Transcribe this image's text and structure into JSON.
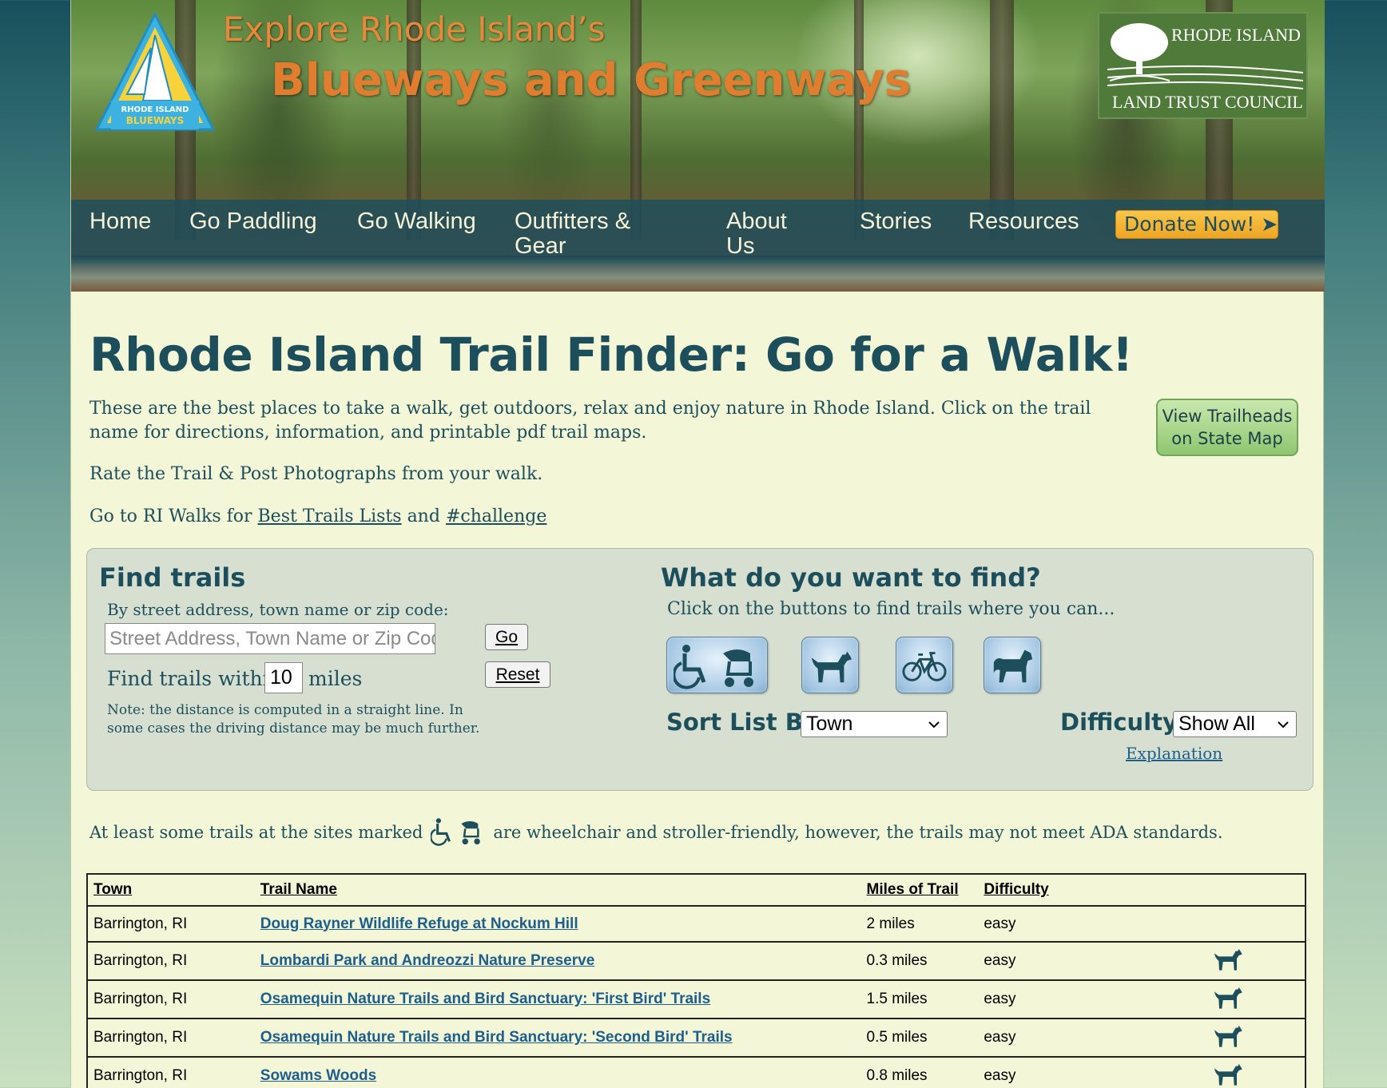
{
  "header": {
    "title_line1": "Explore Rhode Island’s",
    "title_line2": "Blueways and Greenways",
    "logo_text": [
      "RHODE ISLAND",
      "BLUEWAYS"
    ],
    "partner_logo": [
      "RHODE ISLAND",
      "LAND TRUST COUNCIL"
    ]
  },
  "nav": {
    "items": [
      "Home",
      "Go Paddling",
      "Go Walking",
      "Outfitters & Gear",
      "About Us",
      "Stories",
      "Resources"
    ],
    "donate": "Donate Now! ➤"
  },
  "page": {
    "title": "Rhode Island Trail Finder: Go for a Walk!",
    "intro1": "These are the best places to take a walk, get outdoors, relax and enjoy nature in Rhode Island. Click on the trail name for directions, information, and printable pdf trail maps.",
    "intro2": "Rate the Trail & Post Photographs from your walk.",
    "intro3_prefix": "Go to RI Walks for",
    "intro3_link1": "Best Trails Lists",
    "intro3_and": "and",
    "intro3_link2": "#challenge",
    "map_button": [
      "View Trailheads",
      "on State Map"
    ]
  },
  "find": {
    "heading": "Find trails",
    "address_label": "By street address, town name or zip code:",
    "address_placeholder": "Street Address, Town Name or Zip Code",
    "address_value": "",
    "go_label": "Go",
    "reset_label": "Reset",
    "within_prefix": "Find trails within",
    "within_value": "10",
    "within_suffix": "miles",
    "note": "Note: the distance is computed in a straight line. In some cases the driving distance may be much further."
  },
  "what": {
    "heading": "What do you want to find?",
    "subtitle": "Click on the buttons to find trails where you can...",
    "filters": [
      "wheelchair-stroller-icon",
      "dog-icon",
      "bicycle-icon",
      "horse-icon"
    ],
    "sort_label": "Sort List By:",
    "sort_value": "Town",
    "difficulty_label": "Difficulty:",
    "difficulty_value": "Show All",
    "explanation": "Explanation"
  },
  "ada_note": {
    "prefix": "At least some trails at the sites marked",
    "suffix": "are wheelchair and stroller-friendly, however, the trails may not meet ADA standards."
  },
  "table": {
    "headers": [
      "Town",
      "Trail Name",
      "Miles of Trail",
      "Difficulty"
    ],
    "rows": [
      {
        "town": "Barrington, RI",
        "name": "Doug Rayner Wildlife Refuge at Nockum Hill",
        "miles": "2 miles",
        "difficulty": "easy",
        "dog": false
      },
      {
        "town": "Barrington, RI",
        "name": "Lombardi Park and Andreozzi Nature Preserve",
        "miles": "0.3 miles",
        "difficulty": "easy",
        "dog": true
      },
      {
        "town": "Barrington, RI",
        "name": "Osamequin Nature Trails and Bird Sanctuary: 'First Bird' Trails",
        "miles": "1.5 miles",
        "difficulty": "easy",
        "dog": true
      },
      {
        "town": "Barrington, RI",
        "name": "Osamequin Nature Trails and Bird Sanctuary: 'Second Bird' Trails",
        "miles": "0.5 miles",
        "difficulty": "easy",
        "dog": true
      },
      {
        "town": "Barrington, RI",
        "name": "Sowams Woods",
        "miles": "0.8 miles",
        "difficulty": "easy",
        "dog": true
      }
    ]
  },
  "colors": {
    "brand_dark": "#1d4e5b",
    "orange": "#e07d2e",
    "page_bg": "#f4f6d8",
    "link": "#1d5e8a",
    "donate": "#f4b43a"
  }
}
